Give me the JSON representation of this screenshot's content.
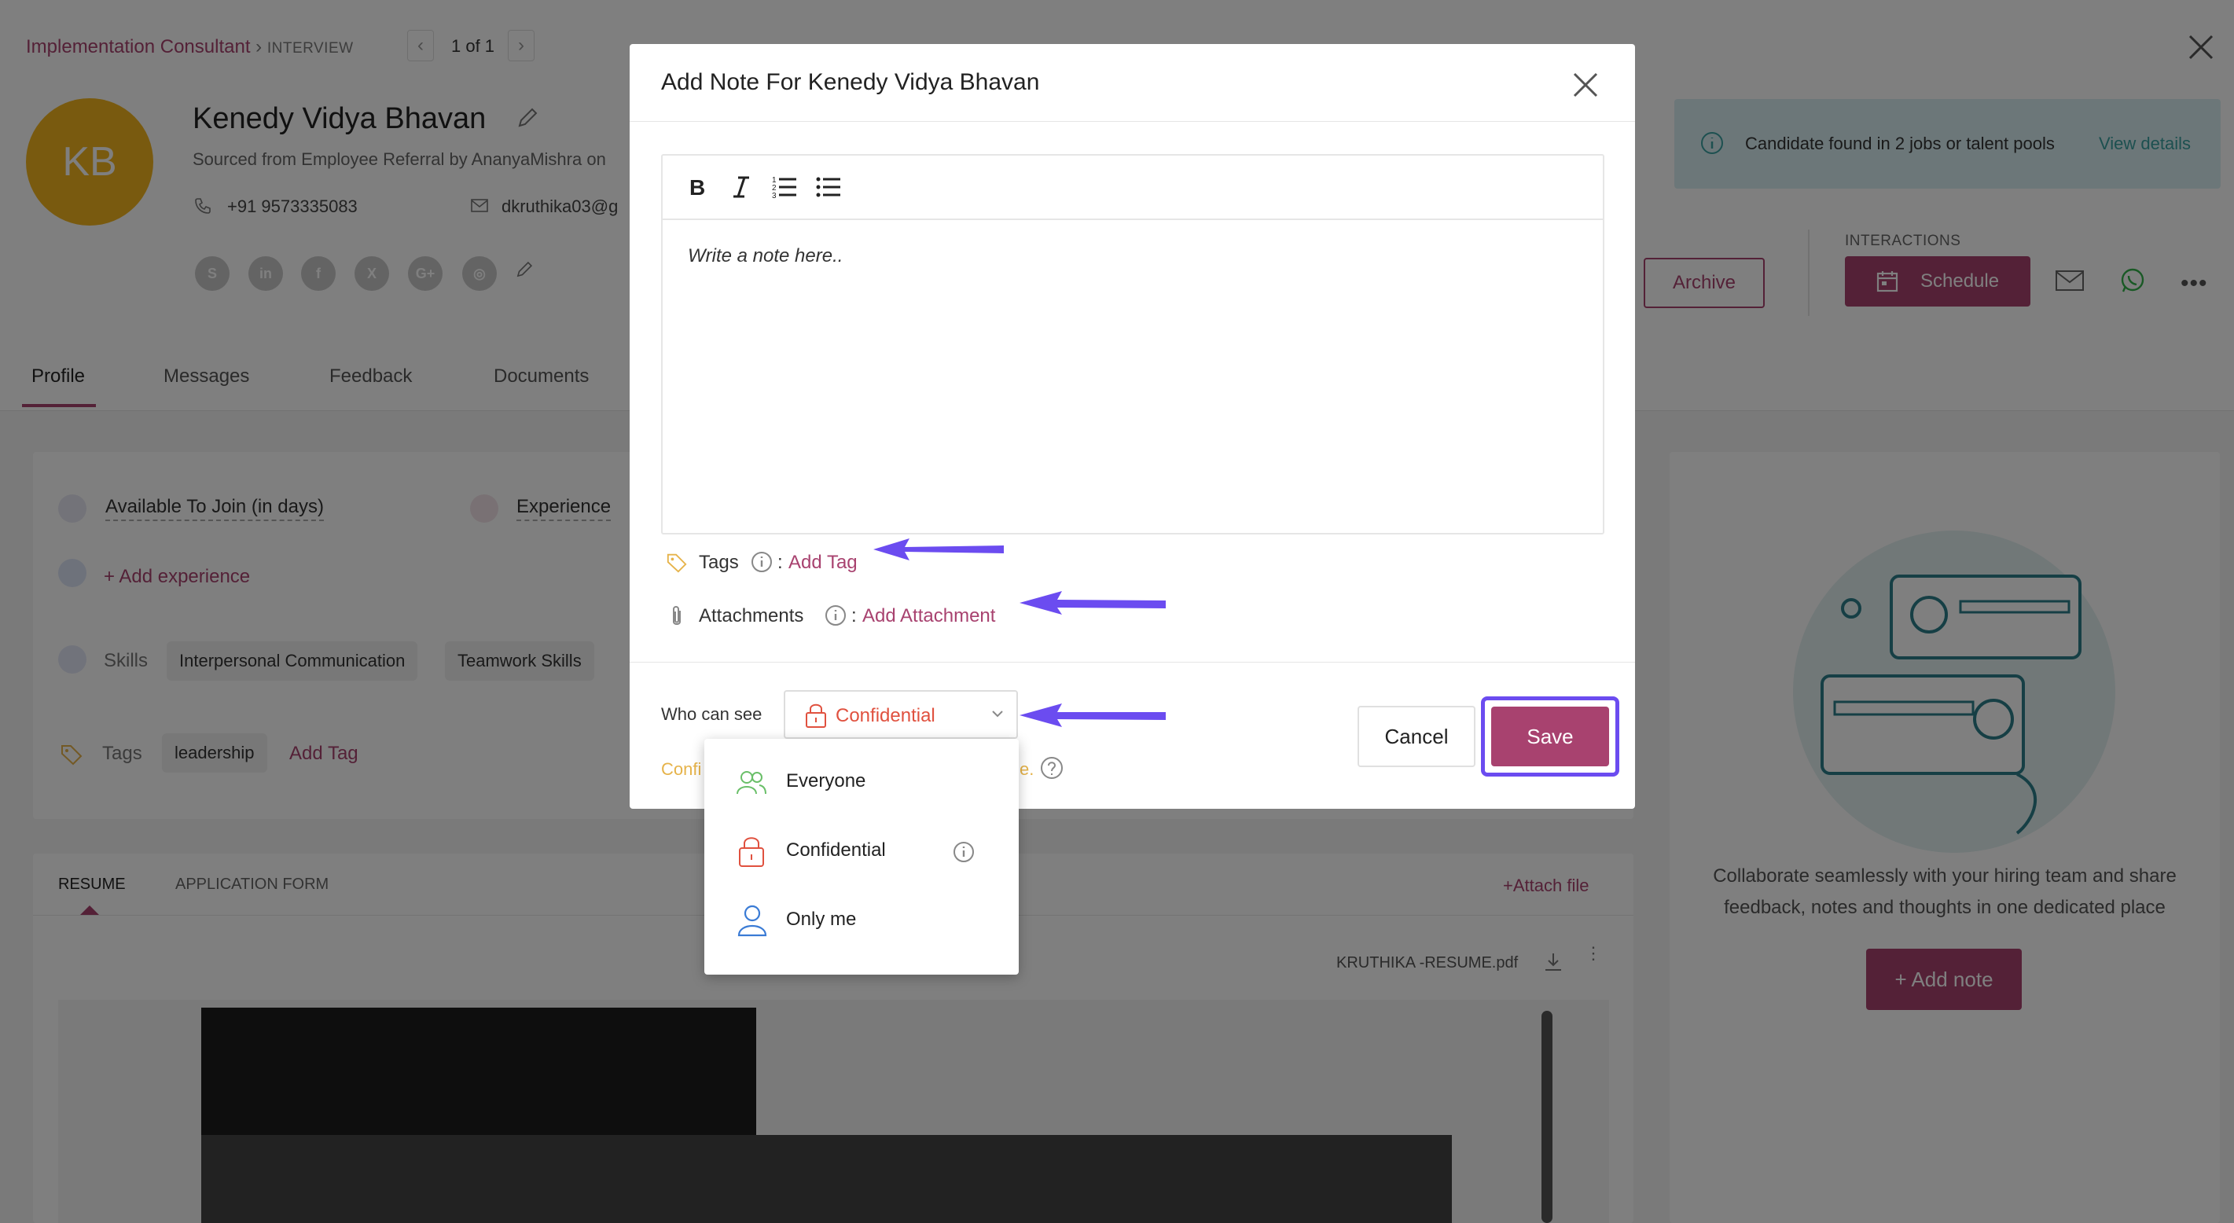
{
  "header": {
    "breadcrumb_job": "Implementation Consultant",
    "breadcrumb_sep": "›",
    "breadcrumb_stage": "INTERVIEW",
    "pager": "1 of 1"
  },
  "candidate": {
    "initials": "KB",
    "name": "Kenedy Vidya Bhavan",
    "source": "Sourced from Employee Referral by AnanyaMishra on",
    "phone": "+91 9573335083",
    "email": "dkruthika03@g"
  },
  "notice": {
    "text": "Candidate found in 2 jobs or talent pools",
    "link": "View details"
  },
  "actions": {
    "archive": "Archive",
    "interactions_label": "INTERACTIONS",
    "schedule": "Schedule"
  },
  "tabs": [
    "Profile",
    "Messages",
    "Feedback",
    "Documents"
  ],
  "profile": {
    "available": "Available To Join (in days)",
    "experience": "Experience",
    "add_experience": "+ Add experience",
    "skills_label": "Skills",
    "skills": [
      "Interpersonal Communication",
      "Teamwork Skills"
    ],
    "tags_label": "Tags",
    "tags": [
      "leadership"
    ],
    "add_tag": "Add Tag"
  },
  "resume": {
    "tab_resume": "RESUME",
    "tab_form": "APPLICATION FORM",
    "attach": "+Attach file",
    "filename": "KRUTHIKA -RESUME.pdf"
  },
  "notes_panel": {
    "text_line1": "Collaborate seamlessly with your hiring team and share",
    "text_line2": "feedback, notes and thoughts in one dedicated place",
    "add_note": "+ Add note"
  },
  "modal": {
    "title": "Add Note For Kenedy Vidya Bhavan",
    "placeholder": "Write a note here..",
    "tags_label": "Tags",
    "add_tag": "Add Tag",
    "attachments_label": "Attachments",
    "add_attachment": "Add Attachment",
    "who_can_see": "Who can see",
    "selected_visibility": "Confidential",
    "hint_left": "Confi",
    "hint_right": "e.",
    "cancel": "Cancel",
    "save": "Save"
  },
  "visibility_options": [
    "Everyone",
    "Confidential",
    "Only me"
  ],
  "colors": {
    "accent": "#a8426f",
    "highlight": "#6b4cf0",
    "confidential": "#e0513f",
    "everyone": "#6abf69",
    "only_me": "#3a7bd5",
    "notice_bg": "#d9eef3"
  }
}
